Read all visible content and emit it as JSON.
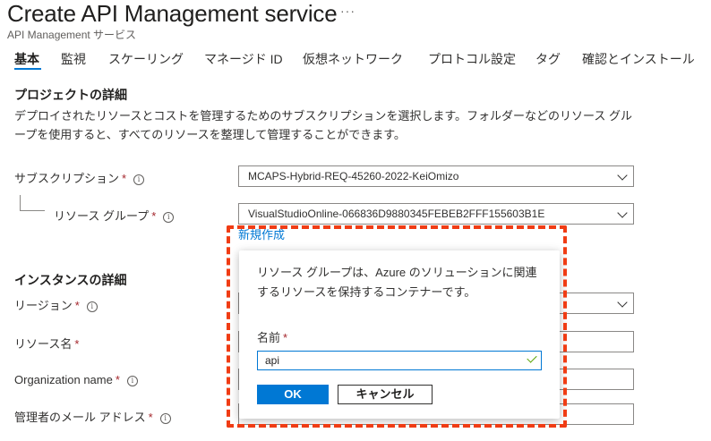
{
  "header": {
    "title": "Create API Management service",
    "more": "···",
    "subtitle": "API Management サービス"
  },
  "tabs": [
    {
      "label": "基本",
      "active": true
    },
    {
      "label": "監視"
    },
    {
      "label": "スケーリング"
    },
    {
      "label": "マネージド ID"
    },
    {
      "label": "仮想ネットワーク"
    },
    {
      "label": "プロトコル設定"
    },
    {
      "label": "タグ"
    },
    {
      "label": "確認とインストール"
    }
  ],
  "project": {
    "heading": "プロジェクトの詳細",
    "description": "デプロイされたリソースとコストを管理するためのサブスクリプションを選択します。フォルダーなどのリソース グループを使用すると、すべてのリソースを整理して管理することができます。",
    "subscription_label": "サブスクリプション",
    "subscription_value": "MCAPS-Hybrid-REQ-45260-2022-KeiOmizo",
    "resource_group_label": "リソース グループ",
    "resource_group_value": "VisualStudioOnline-066836D9880345FEBEB2FFF155603B1E",
    "create_new_link": "新規作成"
  },
  "instance": {
    "heading": "インスタンスの詳細",
    "region_label": "リージョン",
    "resource_name_label": "リソース名",
    "org_name_label": "Organization name",
    "admin_email_label": "管理者のメール アドレス"
  },
  "required_mark": "*",
  "info_glyph": "i",
  "popover": {
    "text": "リソース グループは、Azure のソリューションに関連するリソースを保持するコンテナーです。",
    "name_label": "名前",
    "name_value": "api",
    "ok_label": "OK",
    "cancel_label": "キャンセル"
  },
  "colors": {
    "accent": "#0078d4",
    "required": "#a4262c",
    "highlight": "#f03c14",
    "valid": "#57a300"
  }
}
